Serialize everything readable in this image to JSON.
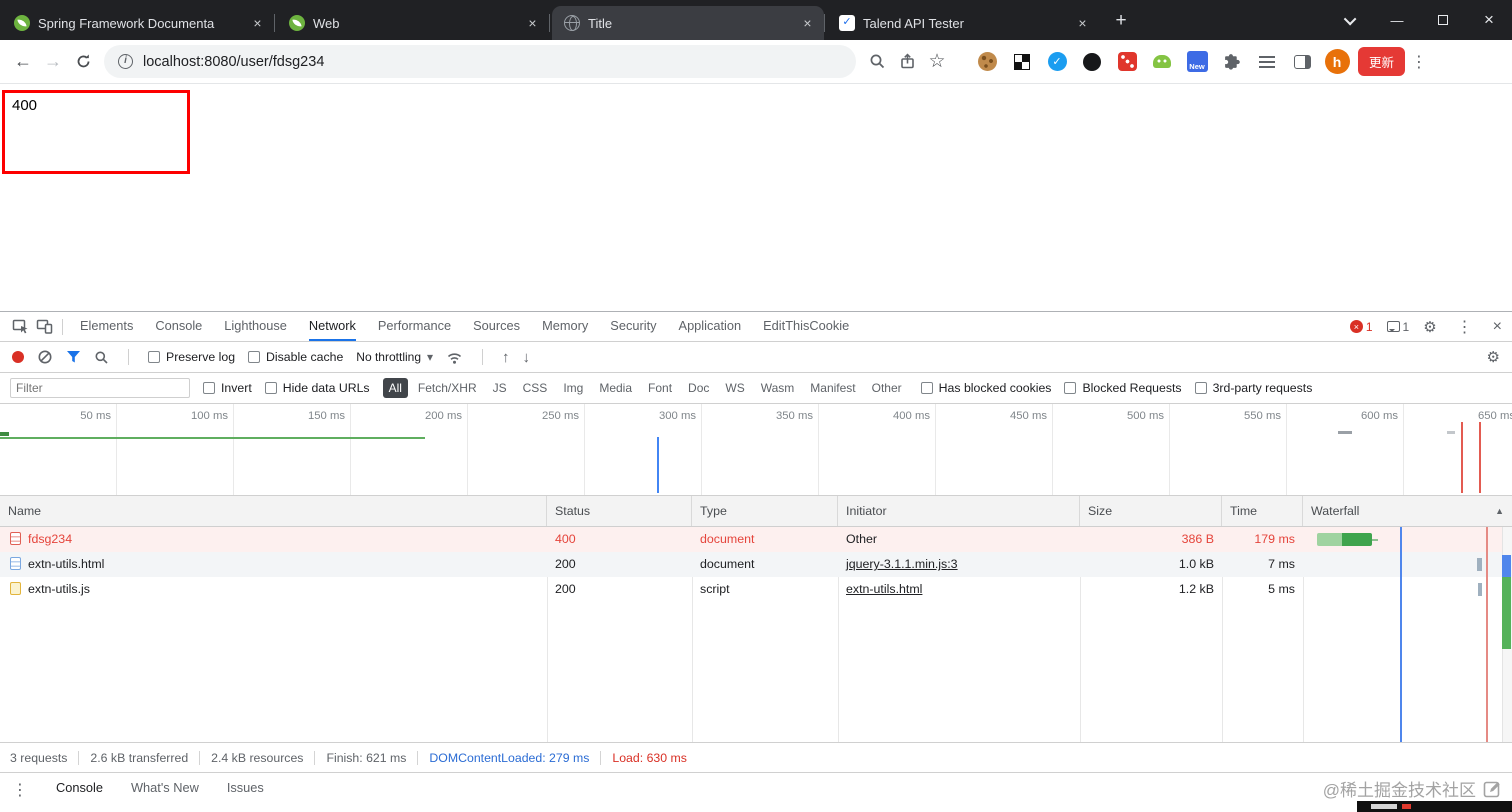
{
  "colors": {
    "accent": "#1a73e8",
    "error_red": "#e5443b",
    "success_green": "#43a047",
    "update_button_red": "#e53935",
    "tabstrip_bg": "#202124"
  },
  "icons": {
    "close": "×",
    "plus": "+",
    "back": "←",
    "forward": "→",
    "star": "☆",
    "kebab": "⋮",
    "caret_down": "▾",
    "sort_asc": "▲",
    "up_arrow": "↑",
    "down_arrow": "↓",
    "gear": "⚙",
    "check": "✓",
    "minimize": "—",
    "info": "i"
  },
  "browser": {
    "tabs": [
      {
        "title": "Spring Framework Documenta"
      },
      {
        "title": "Web"
      },
      {
        "title": "Title"
      },
      {
        "title": "Talend API Tester"
      }
    ],
    "url": "localhost:8080/user/fdsg234",
    "update_button": "更新",
    "new_badge": "New",
    "avatar_letter": "h"
  },
  "page": {
    "error_code": "400"
  },
  "devtools": {
    "tabs": [
      "Elements",
      "Console",
      "Lighthouse",
      "Network",
      "Performance",
      "Sources",
      "Memory",
      "Security",
      "Application",
      "EditThisCookie"
    ],
    "error_badge": "1",
    "issue_badge": "1",
    "controls": {
      "preserve_log": "Preserve log",
      "disable_cache": "Disable cache",
      "throttling": "No throttling"
    },
    "filter": {
      "placeholder": "Filter",
      "invert": "Invert",
      "hide_data_urls": "Hide data URLs",
      "types": [
        "All",
        "Fetch/XHR",
        "JS",
        "CSS",
        "Img",
        "Media",
        "Font",
        "Doc",
        "WS",
        "Wasm",
        "Manifest",
        "Other"
      ],
      "has_blocked_cookies": "Has blocked cookies",
      "blocked_requests": "Blocked Requests",
      "third_party_requests": "3rd-party requests"
    },
    "timeline_ticks": [
      "50 ms",
      "100 ms",
      "150 ms",
      "200 ms",
      "250 ms",
      "300 ms",
      "350 ms",
      "400 ms",
      "450 ms",
      "500 ms",
      "550 ms",
      "600 ms",
      "650 ms"
    ],
    "table": {
      "columns": [
        "Name",
        "Status",
        "Type",
        "Initiator",
        "Size",
        "Time",
        "Waterfall"
      ],
      "rows": [
        {
          "name": "fdsg234",
          "status": "400",
          "type": "document",
          "initiator": "Other",
          "size": "386 B",
          "time": "179 ms"
        },
        {
          "name": "extn-utils.html",
          "status": "200",
          "type": "document",
          "initiator": "jquery-3.1.1.min.js:3",
          "size": "1.0 kB",
          "time": "7 ms"
        },
        {
          "name": "extn-utils.js",
          "status": "200",
          "type": "script",
          "initiator": "extn-utils.html",
          "size": "1.2 kB",
          "time": "5 ms"
        }
      ]
    },
    "summary": {
      "requests": "3 requests",
      "transferred": "2.6 kB transferred",
      "resources": "2.4 kB resources",
      "finish": "Finish: 621 ms",
      "dom_content_loaded": "DOMContentLoaded: 279 ms",
      "load": "Load: 630 ms"
    },
    "drawer_tabs": [
      "Console",
      "What's New",
      "Issues"
    ]
  },
  "watermark": "@稀土掘金技术社区"
}
